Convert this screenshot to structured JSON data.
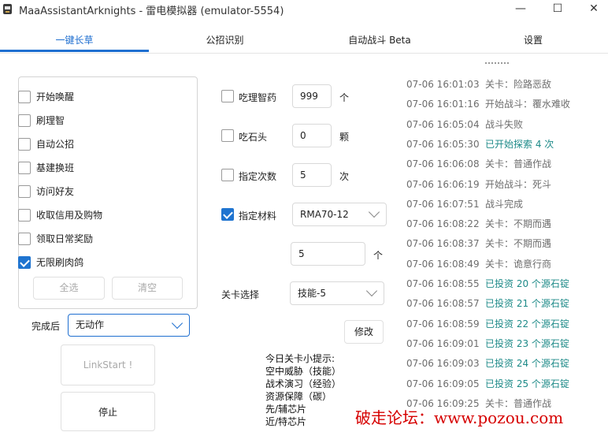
{
  "window": {
    "title": "MaaAssistantArknights - 雷电模拟器 (emulator-5554)",
    "minimize_glyph": "—",
    "maximize_glyph": "☐",
    "close_glyph": "✕"
  },
  "tabs": [
    {
      "label": "一键长草",
      "active": true
    },
    {
      "label": "公招识别",
      "active": false
    },
    {
      "label": "自动战斗 Beta",
      "active": false
    },
    {
      "label": "设置",
      "active": false
    }
  ],
  "tasks": [
    {
      "label": "开始唤醒",
      "checked": false
    },
    {
      "label": "刷理智",
      "checked": false
    },
    {
      "label": "自动公招",
      "checked": false
    },
    {
      "label": "基建换班",
      "checked": false
    },
    {
      "label": "访问好友",
      "checked": false
    },
    {
      "label": "收取信用及购物",
      "checked": false
    },
    {
      "label": "领取日常奖励",
      "checked": false
    },
    {
      "label": "无限刷肉鸽",
      "checked": true
    }
  ],
  "task_buttons": {
    "select_all": "全选",
    "clear": "清空"
  },
  "after_finish": {
    "label": "完成后",
    "value": "无动作"
  },
  "actions": {
    "link_start": "LinkStart !",
    "stop": "停止"
  },
  "options": {
    "sanity_potion": {
      "label": "吃理智药",
      "checked": false,
      "value": "999",
      "unit": "个"
    },
    "originium": {
      "label": "吃石头",
      "checked": false,
      "value": "0",
      "unit": "颗"
    },
    "times": {
      "label": "指定次数",
      "checked": false,
      "value": "5",
      "unit": "次"
    },
    "material": {
      "label": "指定材料",
      "checked": true,
      "value": "RMA70-12",
      "count": "5",
      "unit": "个"
    },
    "stage": {
      "label": "关卡选择",
      "value": "技能-5"
    },
    "modify_button": "修改"
  },
  "tips": {
    "title": "今日关卡小提示:",
    "lines": [
      "空中威胁（技能）",
      "战术演习（经验）",
      "资源保障（碳）",
      "先/辅芯片",
      "近/特芯片"
    ]
  },
  "log": [
    {
      "time": "07-06  16:01:03",
      "msg": "关卡：险路恶敌",
      "highlight": false
    },
    {
      "time": "07-06  16:01:16",
      "msg": "开始战斗：覆水难收",
      "highlight": false
    },
    {
      "time": "07-06  16:05:04",
      "msg": "战斗失败",
      "highlight": false
    },
    {
      "time": "07-06  16:05:30",
      "msg": "已开始探索 4 次",
      "highlight": true
    },
    {
      "time": "07-06  16:06:08",
      "msg": "关卡：普通作战",
      "highlight": false
    },
    {
      "time": "07-06  16:06:19",
      "msg": "开始战斗：死斗",
      "highlight": false
    },
    {
      "time": "07-06  16:07:51",
      "msg": "战斗完成",
      "highlight": false
    },
    {
      "time": "07-06  16:08:22",
      "msg": "关卡：不期而遇",
      "highlight": false
    },
    {
      "time": "07-06  16:08:37",
      "msg": "关卡：不期而遇",
      "highlight": false
    },
    {
      "time": "07-06  16:08:49",
      "msg": "关卡：诡意行商",
      "highlight": false
    },
    {
      "time": "07-06  16:08:55",
      "msg": "已投资 20 个源石锭",
      "highlight": true
    },
    {
      "time": "07-06  16:08:57",
      "msg": "已投资 21 个源石锭",
      "highlight": true
    },
    {
      "time": "07-06  16:08:59",
      "msg": "已投资 22 个源石锭",
      "highlight": true
    },
    {
      "time": "07-06  16:09:01",
      "msg": "已投资 23 个源石锭",
      "highlight": true
    },
    {
      "time": "07-06  16:09:03",
      "msg": "已投资 24 个源石锭",
      "highlight": true
    },
    {
      "time": "07-06  16:09:05",
      "msg": "已投资 25 个源石锭",
      "highlight": true
    },
    {
      "time": "07-06  16:09:25",
      "msg": "关卡：普通作战",
      "highlight": false
    }
  ],
  "watermark": "破走论坛：www.pozou.com"
}
